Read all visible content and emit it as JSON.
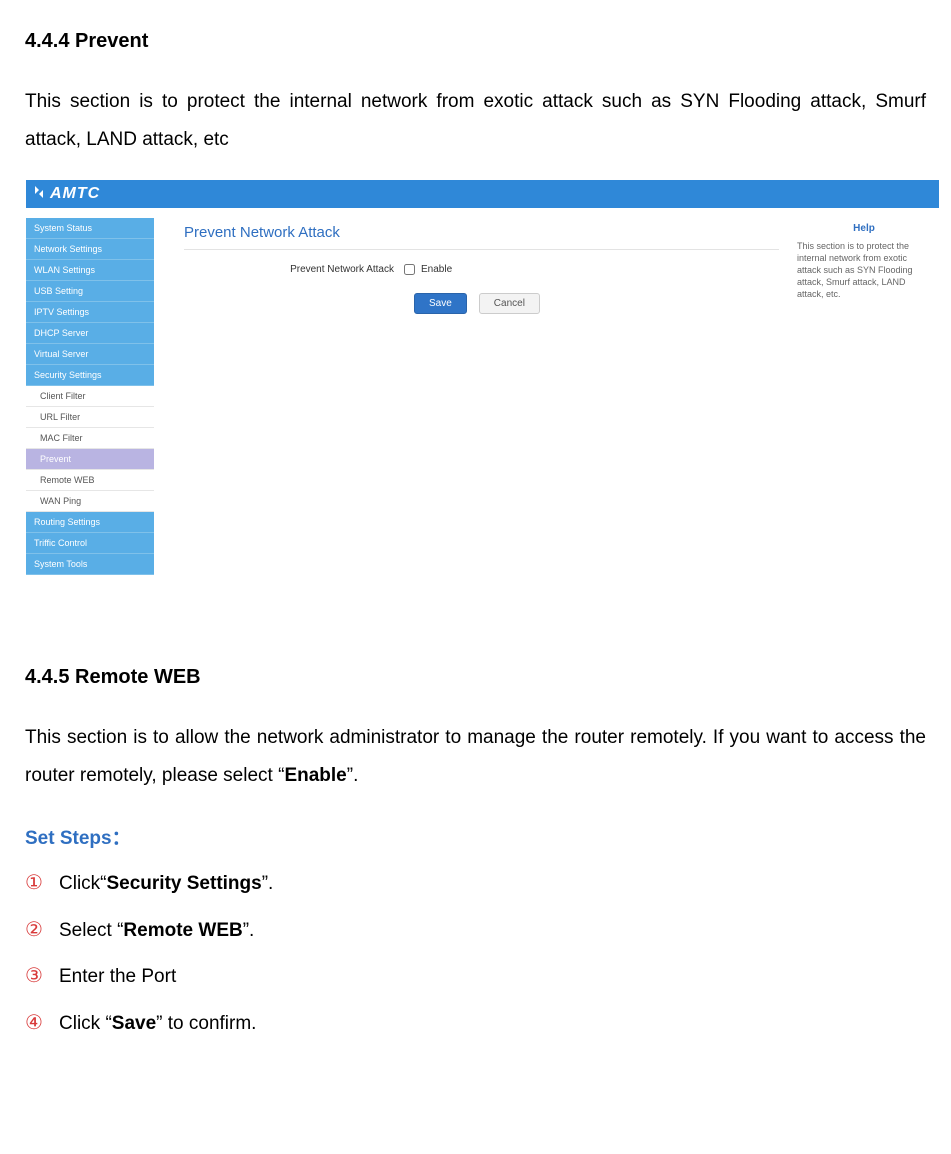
{
  "sec1": {
    "heading": "4.4.4 Prevent",
    "intro": "This section is to protect the internal network from exotic attack such as SYN Flooding attack, Smurf attack, LAND attack, etc"
  },
  "ui": {
    "brand": "AMTC",
    "sidebar": {
      "items": [
        {
          "label": "System Status",
          "type": "nav"
        },
        {
          "label": "Network Settings",
          "type": "nav"
        },
        {
          "label": "WLAN Settings",
          "type": "nav"
        },
        {
          "label": "USB Setting",
          "type": "nav"
        },
        {
          "label": "IPTV Settings",
          "type": "nav"
        },
        {
          "label": "DHCP Server",
          "type": "nav"
        },
        {
          "label": "Virtual Server",
          "type": "nav"
        },
        {
          "label": "Security Settings",
          "type": "nav"
        },
        {
          "label": "Client Filter",
          "type": "sub"
        },
        {
          "label": "URL Filter",
          "type": "sub"
        },
        {
          "label": "MAC Filter",
          "type": "sub"
        },
        {
          "label": "Prevent",
          "type": "sub-active"
        },
        {
          "label": "Remote WEB",
          "type": "sub"
        },
        {
          "label": "WAN Ping",
          "type": "sub"
        },
        {
          "label": "Routing Settings",
          "type": "nav"
        },
        {
          "label": "Triffic Control",
          "type": "nav"
        },
        {
          "label": "System Tools",
          "type": "nav"
        }
      ]
    },
    "panel": {
      "title": "Prevent Network Attack",
      "field_label": "Prevent Network Attack",
      "enable_label": "Enable",
      "save": "Save",
      "cancel": "Cancel"
    },
    "help": {
      "title": "Help",
      "text": "This section is to protect the internal network from exotic attack such as SYN Flooding attack, Smurf attack, LAND attack, etc."
    }
  },
  "sec2": {
    "heading": "4.4.5 Remote WEB",
    "intro_pre": "This section is to allow the network administrator to manage the router remotely. If you want to access the router remotely, please select “",
    "intro_bold": "Enable",
    "intro_post": "”.",
    "steps_heading": "Set Steps：",
    "steps": [
      {
        "num": "①",
        "pre": "Click“",
        "bold": "Security Settings",
        "post": "”."
      },
      {
        "num": "②",
        "pre": "Select “",
        "bold": "Remote WEB",
        "post": "”."
      },
      {
        "num": "③",
        "pre": "Enter the Port",
        "bold": "",
        "post": ""
      },
      {
        "num": "④",
        "pre": "Click “",
        "bold": "Save",
        "post": "” to confirm."
      }
    ]
  }
}
